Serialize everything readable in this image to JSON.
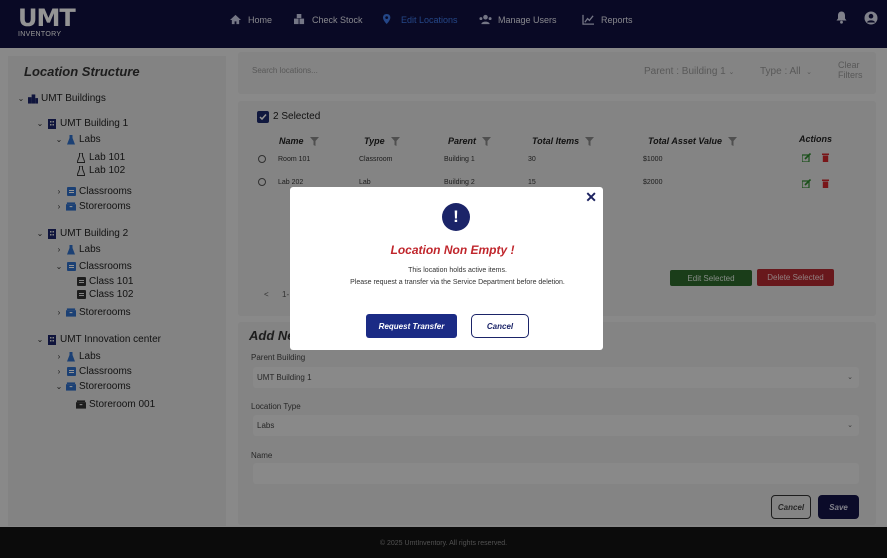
{
  "app": {
    "logo_mark": "UMT",
    "logo_text": "INVENTORY"
  },
  "colors": {
    "navbar": "#111140",
    "active_nav": "#3e79e8",
    "primary": "#1b2468",
    "danger": "#c0262c",
    "success": "#2d6a2c"
  },
  "nav": {
    "items": [
      {
        "label": "Home",
        "icon": "home-icon"
      },
      {
        "label": "Check Stock",
        "icon": "boxes-icon"
      },
      {
        "label": "Edit Locations",
        "icon": "location-pin-icon",
        "active": true
      },
      {
        "label": "Manage Users",
        "icon": "users-icon"
      },
      {
        "label": "Reports",
        "icon": "chart-icon"
      }
    ],
    "right_icons": [
      "bell-icon",
      "user-avatar-icon"
    ]
  },
  "sidebar": {
    "title": "Location Structure",
    "tree": {
      "root": "UMT Buildings",
      "b1": "UMT Building 1",
      "b1_labs": "Labs",
      "b1_lab101": "Lab 101",
      "b1_lab102": "Lab 102",
      "b1_classrooms": "Classrooms",
      "b1_storerooms": "Storerooms",
      "b2": "UMT Building 2",
      "b2_labs": "Labs",
      "b2_classrooms": "Classrooms",
      "b2_class101": "Class 101",
      "b2_class102": "Class 102",
      "b2_storerooms": "Storerooms",
      "b3": "UMT Innovation center",
      "b3_labs": "Labs",
      "b3_classrooms": "Classrooms",
      "b3_storerooms": "Storerooms",
      "b3_store001": "Storeroom 001"
    }
  },
  "search": {
    "placeholder": "Search locations...",
    "parent_filter": "Parent : Building 1",
    "type_filter": "Type : All",
    "clear_l1": "Clear",
    "clear_l2": "Filters"
  },
  "table": {
    "selected_label": "2 Selected",
    "headers": {
      "name": "Name",
      "type": "Type",
      "parent": "Parent",
      "total": "Total Items",
      "value": "Total Asset Value",
      "actions": "Actions"
    },
    "rows": [
      {
        "name": "Room 101",
        "type": "Classroom",
        "parent": "Building 1",
        "total": "30",
        "value": "$1000"
      },
      {
        "name": "Lab 202",
        "type": "Lab",
        "parent": "Building 2",
        "total": "15",
        "value": "$2000"
      }
    ],
    "edit_selected": "Edit Selected",
    "delete_selected": "Delete Selected",
    "pagination_prev": "<",
    "pagination_info": "1-"
  },
  "form": {
    "title": "Add New",
    "parent_label": "Parent Building",
    "parent_value": "UMT Building 1",
    "type_label": "Location Type",
    "type_value": "Labs",
    "name_label": "Name",
    "cancel": "Cancel",
    "save": "Save"
  },
  "modal": {
    "close": "✕",
    "icon_glyph": "!",
    "title": "Location Non Empty !",
    "msg1": "This location holds active items.",
    "msg2": "Please request a transfer via the Service Department before deletion.",
    "request": "Request Transfer",
    "cancel": "Cancel"
  },
  "footer": {
    "text": "© 2025 UmtInventory. All rights reserved."
  }
}
